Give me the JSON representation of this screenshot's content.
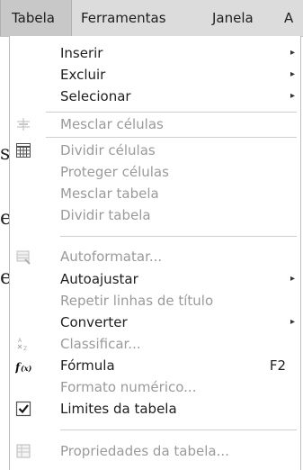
{
  "menubar": {
    "items": [
      {
        "label": "Tabela",
        "active": true
      },
      {
        "label": "Ferramentas"
      },
      {
        "label": "Janela"
      },
      {
        "label": "A"
      }
    ]
  },
  "background_chars": [
    "s,",
    "e",
    "e"
  ],
  "menu": {
    "items": [
      {
        "label": "Inserir",
        "submenu": true,
        "enabled": true
      },
      {
        "label": "Excluir",
        "submenu": true,
        "enabled": true
      },
      {
        "label": "Selecionar",
        "submenu": true,
        "enabled": true
      },
      {
        "label": "Mesclar células",
        "enabled": false,
        "icon": "merge-cells-icon"
      },
      {
        "label": "Dividir células",
        "enabled": false,
        "icon": "split-cells-icon"
      },
      {
        "label": "Proteger células",
        "enabled": false
      },
      {
        "label": "Mesclar tabela",
        "enabled": false
      },
      {
        "label": "Dividir tabela",
        "enabled": false
      },
      {
        "label": "Autoformatar...",
        "enabled": false,
        "icon": "autoformat-icon"
      },
      {
        "label": "Autoajustar",
        "submenu": true,
        "enabled": true
      },
      {
        "label": "Repetir linhas de título",
        "enabled": false
      },
      {
        "label": "Converter",
        "submenu": true,
        "enabled": true
      },
      {
        "label": "Classificar...",
        "enabled": false,
        "icon": "sort-icon"
      },
      {
        "label": "Fórmula",
        "accel": "F2",
        "enabled": true,
        "icon": "formula-icon"
      },
      {
        "label": "Formato numérico...",
        "enabled": false
      },
      {
        "label": "Limites da tabela",
        "enabled": true,
        "checked": true,
        "icon": "checkbox-checked-icon"
      },
      {
        "label": "Propriedades da tabela...",
        "enabled": false,
        "icon": "table-properties-icon"
      }
    ]
  }
}
